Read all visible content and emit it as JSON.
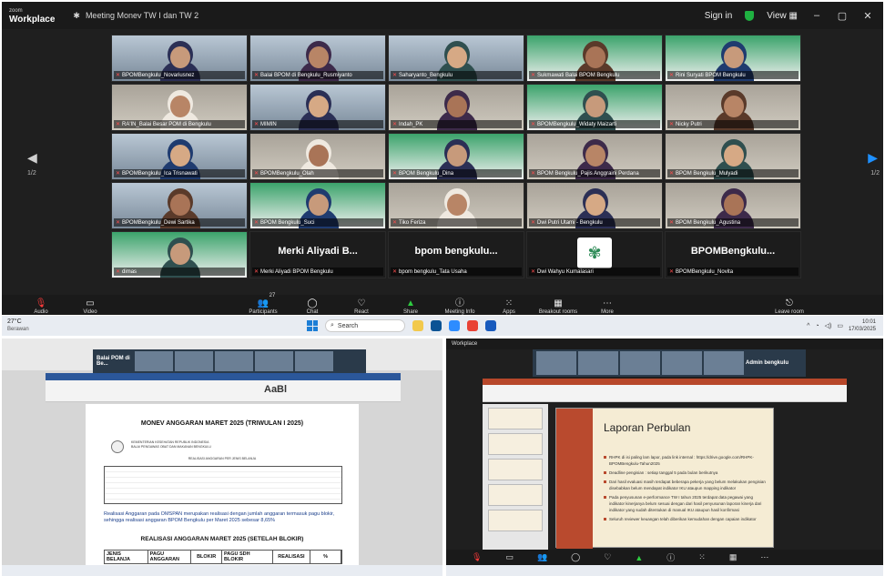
{
  "zoom": {
    "brand_small": "zoom",
    "brand": "Workplace",
    "meeting_title": "Meeting  Monev TW I dan TW 2",
    "sign_in": "Sign in",
    "view": "View",
    "page_indicator_left": "1/2",
    "page_indicator_right": "1/2",
    "participants_count": "27",
    "tiles": [
      {
        "name": "BPOMBengkulu_Novariusnez",
        "kind": "video",
        "scene": "building"
      },
      {
        "name": "Balai BPOM di Bengkulu_Rusmiyanto",
        "kind": "video",
        "scene": "building"
      },
      {
        "name": "Saharyanto_Bengkulu",
        "kind": "video",
        "scene": "building"
      },
      {
        "name": "Sukmawati Balai BPOM Bengkulu",
        "kind": "video",
        "scene": "slide"
      },
      {
        "name": "Rini Suryati BPOM Bengkulu",
        "kind": "video",
        "scene": "slide"
      },
      {
        "name": "RA'IN_Balai Besar POM di Bengkulu",
        "kind": "video",
        "scene": "office"
      },
      {
        "name": "MIMIN",
        "kind": "video",
        "scene": "building"
      },
      {
        "name": "Indah_PK",
        "kind": "video",
        "scene": "office"
      },
      {
        "name": "BPOMBengkulu_Widaty Maizarti",
        "kind": "video",
        "scene": "slide"
      },
      {
        "name": "Nicky Putri",
        "kind": "video",
        "scene": "office"
      },
      {
        "name": "BPOMBengkulu_Ica Trisnawati",
        "kind": "video",
        "scene": "building"
      },
      {
        "name": "BPOMBengkulu_Olah",
        "kind": "video",
        "scene": "office"
      },
      {
        "name": "BPOM Bengkulu_Dina",
        "kind": "video",
        "scene": "slide"
      },
      {
        "name": "BPOM Bengkulu_Pajis Anggraini Perdana",
        "kind": "video",
        "scene": "office"
      },
      {
        "name": "BPOM Bengkulu_Mulyadi",
        "kind": "video",
        "scene": "office"
      },
      {
        "name": "BPOMBengkulu_Dewi Sartika",
        "kind": "video",
        "scene": "building"
      },
      {
        "name": "BPOM Bengkulu_Suci",
        "kind": "video",
        "scene": "slide"
      },
      {
        "name": "Tiko Feriza",
        "kind": "video",
        "scene": "office"
      },
      {
        "name": "Dwi Putri Utami - Bengkulu",
        "kind": "video",
        "scene": "office"
      },
      {
        "name": "BPOM Bengkulu_Agustina",
        "kind": "video",
        "scene": "office"
      },
      {
        "name": "dimas",
        "kind": "video",
        "scene": "slide"
      },
      {
        "name": "Merki Aliyadi B...",
        "kind": "text",
        "footer": "Merki Aliyadi BPOM Bengkulu"
      },
      {
        "name": "bpom bengkulu...",
        "kind": "text",
        "footer": "bpom bengkulu_Tata Usaha"
      },
      {
        "name": "",
        "kind": "logo",
        "footer": "Dwi Wahyu Kumalasari"
      },
      {
        "name": "BPOMBengkulu...",
        "kind": "text",
        "footer": "BPOMBengkulu_Novita"
      }
    ],
    "toolbar": [
      {
        "label": "Audio",
        "icon": "mic-off-icon"
      },
      {
        "label": "Video",
        "icon": "video-off-icon"
      },
      {
        "label": "Participants",
        "icon": "participants-icon"
      },
      {
        "label": "Chat",
        "icon": "chat-icon"
      },
      {
        "label": "React",
        "icon": "heart-icon"
      },
      {
        "label": "Share",
        "icon": "share-icon"
      },
      {
        "label": "Meeting Info",
        "icon": "info-icon"
      },
      {
        "label": "Apps",
        "icon": "apps-icon"
      },
      {
        "label": "Breakout rooms",
        "icon": "breakout-icon"
      },
      {
        "label": "More",
        "icon": "more-icon"
      },
      {
        "label": "Leave room",
        "icon": "leave-icon"
      }
    ]
  },
  "taskbar": {
    "weather_temp": "27°C",
    "weather_text": "Berawan",
    "search_placeholder": "Search",
    "time": "10:01",
    "date": "17/03/2025"
  },
  "left_share": {
    "presenter": "Balai POM di Be...",
    "doc_title": "MONEV ANGGARAN MARET 2025 (TRIWULAN I 2025)",
    "doc_head1": "KEMENTERIAN KESEHATAN REPUBLIK INDONESIA",
    "doc_head2": "BALAI PENGAWAS OBAT DAN MAKANAN BENGKULU",
    "doc_sub": "REALISASI ANGGARAN PER JENIS BELANJA",
    "doc_para": "Realisasi Anggaran pada OMSPAN merupakan realisasi dengan jumlah anggaran termasuk pagu blokir, sehingga realisasi anggaran BPOM Bengkulu per Maret 2025 sebesar 8,65%",
    "doc_title2": "REALISASI ANGGARAN MARET 2025 (SETELAH BLOKIR)",
    "table2_headers": [
      "JENIS BELANJA",
      "PAGU ANGGARAN",
      "BLOKIR",
      "PAGU SDH BLOKIR",
      "REALISASI",
      "%"
    ]
  },
  "right_share": {
    "presenter": "Admin bengkulu",
    "slide_title": "Laporan Perbulan",
    "bullets": [
      "RHPK di isi paling lam lapor, pada link internal : https://drive.google.com/RHPK-BPOMBengkulu-Tahun2025",
      "Deadline pengisian : setiap tanggal 5 pada bulan berikutnya",
      "Dari hasil evaluasi masih terdapat beberapa pekerja yang belum melakukan pengisian disebabkan belum mendapat indikator IKU ataupun mapping indikator",
      "Pada penyusunan e-performance TW I tahun 2025 terdapat data pegawai yang indikator kinerjanya belum sesuai dengan dari hasil penyusunan laporan kinerja dari indikator yang sudah ditentukan di manual IKU ataupun hasil konfirmasi",
      "Seluruh reviewer keuangan telah diberikan kemudahan dengan capaian indikator"
    ]
  },
  "colors": {
    "zoom_bg": "#1f1f1f",
    "accent_blue": "#1e90ff",
    "mic_red": "#ff3b3b",
    "share_green": "#2ecc40",
    "ppt_accent": "#b94a2e"
  }
}
